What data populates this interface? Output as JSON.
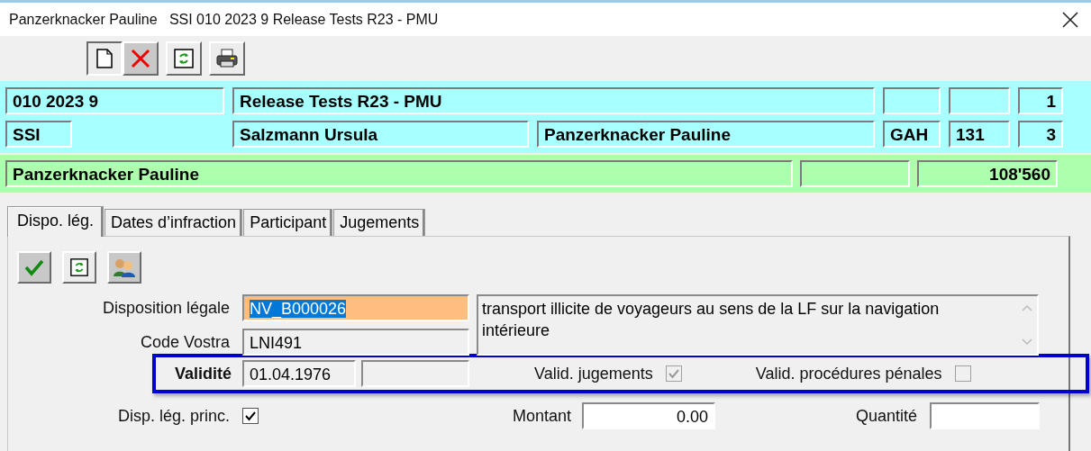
{
  "window": {
    "title": "Panzerknacker Pauline   SSI 010 2023 9 Release Tests R23 - PMU"
  },
  "case_header": {
    "number": "010 2023 9",
    "title": "Release Tests R23 - PMU",
    "count": "1",
    "office": "SSI",
    "clerk": "Salzmann Ursula",
    "person": "Panzerknacker Pauline",
    "code": "GAH",
    "code_2": "131",
    "count_2": "3"
  },
  "party": {
    "name": "Panzerknacker Pauline",
    "amount": "108'560"
  },
  "tabs": [
    {
      "label": "Dispo. lég.",
      "selected": true
    },
    {
      "label": "Dates d’infraction",
      "selected": false
    },
    {
      "label": "Participant",
      "selected": false
    },
    {
      "label": "Jugements",
      "selected": false
    }
  ],
  "form": {
    "legal_disposition": {
      "label": "Disposition légale",
      "value": "NV_B000026",
      "highlighted": true,
      "text_selected": true
    },
    "description": {
      "text": "transport illicite de voyageurs au sens de la LF sur la navigation intérieure"
    },
    "vostra_code": {
      "label": "Code Vostra",
      "value": "LNI491"
    },
    "validity": {
      "label": "Validité",
      "value": "01.04.1976"
    },
    "valid_judgments": {
      "label": "Valid. jugements",
      "checked": true,
      "disabled": true
    },
    "valid_proceedings": {
      "label": "Valid. procédures pénales",
      "checked": false,
      "disabled": true
    },
    "main_disposition": {
      "label": "Disp. lég. princ.",
      "checked": true,
      "disabled": false
    },
    "amount": {
      "label": "Montant",
      "value": "0.00"
    },
    "quantity": {
      "label": "Quantité"
    }
  }
}
